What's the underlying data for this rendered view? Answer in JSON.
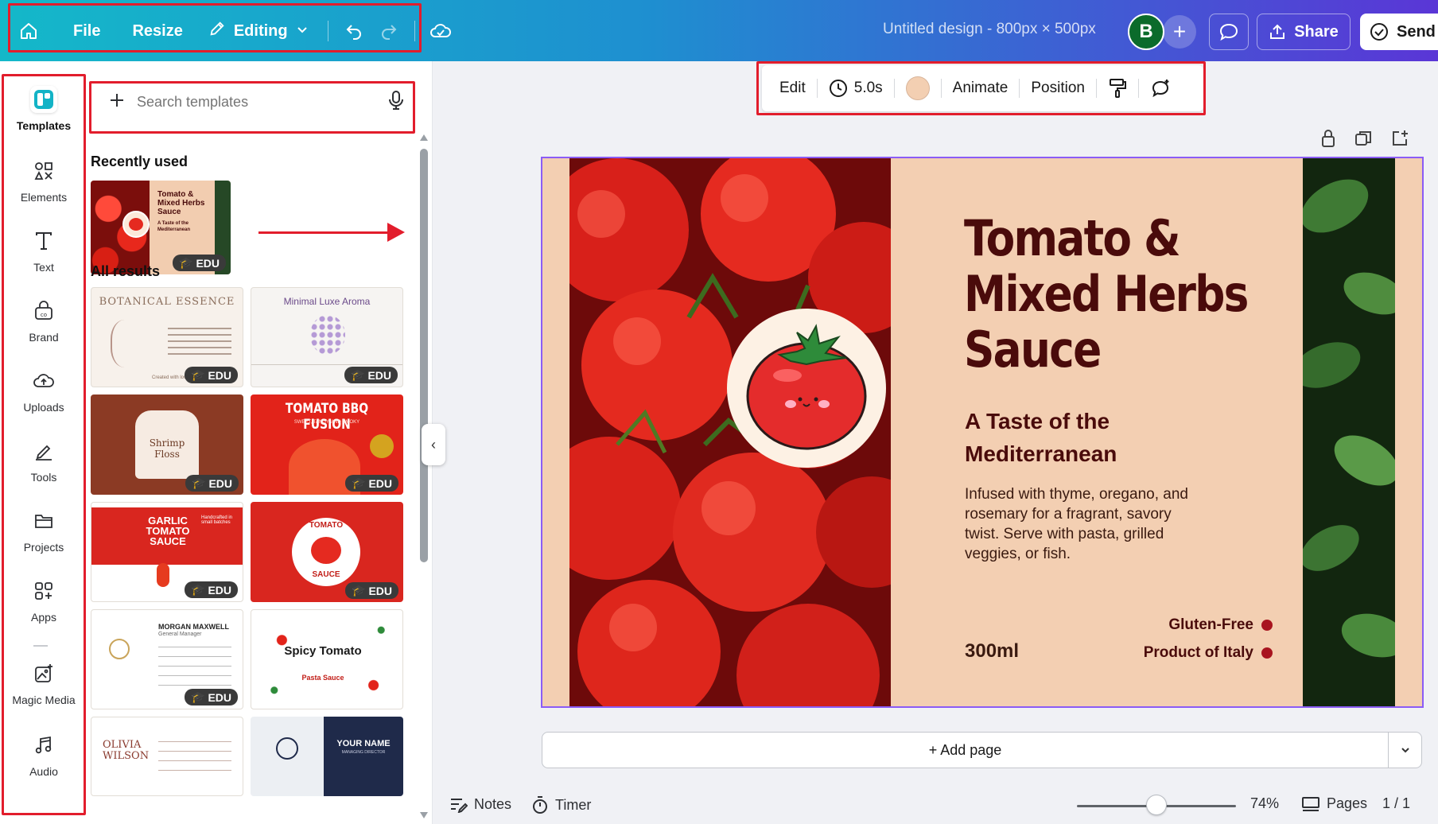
{
  "topbar": {
    "file": "File",
    "resize": "Resize",
    "editing": "Editing",
    "doc_title": "Untitled design - 800px × 500px",
    "avatar_initial": "B",
    "share": "Share",
    "send": "Send"
  },
  "rail": {
    "items": [
      {
        "label": "Templates",
        "icon": "templates-icon"
      },
      {
        "label": "Elements",
        "icon": "elements-icon"
      },
      {
        "label": "Text",
        "icon": "text-icon"
      },
      {
        "label": "Brand",
        "icon": "brand-icon"
      },
      {
        "label": "Uploads",
        "icon": "uploads-icon"
      },
      {
        "label": "Tools",
        "icon": "tools-icon"
      },
      {
        "label": "Projects",
        "icon": "projects-icon"
      },
      {
        "label": "Apps",
        "icon": "apps-icon"
      },
      {
        "label": "Magic Media",
        "icon": "magic-media-icon"
      },
      {
        "label": "Audio",
        "icon": "audio-icon"
      }
    ]
  },
  "panel": {
    "search_placeholder": "Search templates",
    "recently_used": "Recently used",
    "all_results": "All results",
    "edu_badge": "EDU",
    "recent_thumb": {
      "line1": "Tomato &",
      "line2": "Mixed Herbs",
      "line3": "Sauce",
      "line4": "A Taste of the",
      "line5": "Mediterranean"
    },
    "results": [
      {
        "title": "BOTANICAL ESSENCE",
        "sub": "Created with love"
      },
      {
        "title": "Minimal Luxe Aroma",
        "sub": ""
      },
      {
        "title": "Shrimp Floss",
        "sub": ""
      },
      {
        "title": "TOMATO BBQ FUSION",
        "sub": "SWEET, TANGY, AND SMOKY"
      },
      {
        "title": "GARLIC TOMATO SAUCE",
        "sub": "Handcrafted in small batches"
      },
      {
        "title": "TOMATO",
        "sub": "SAUCE"
      },
      {
        "title": "MORGAN MAXWELL",
        "sub": "General Manager"
      },
      {
        "title": "Spicy Tomato",
        "sub": "Pasta Sauce"
      },
      {
        "title": "OLIVIA WILSON",
        "sub": ""
      },
      {
        "title": "YOUR NAME",
        "sub": "MANAGING DIRECTOR"
      }
    ]
  },
  "context_bar": {
    "edit": "Edit",
    "duration": "5.0s",
    "swatch_color": "#f3cfb2",
    "animate": "Animate",
    "position": "Position"
  },
  "design": {
    "title": "Tomato &\nMixed Herbs\nSauce",
    "subtitle": "A Taste of the\nMediterranean",
    "body": "Infused with thyme, oregano, and rosemary for a fragrant, savory twist. Serve with pasta, grilled veggies, or fish.",
    "volume": "300ml",
    "tag1": "Gluten-Free",
    "tag2": "Product of Italy",
    "bg_color": "#f3cfb2",
    "text_color": "#4a0b0b"
  },
  "canvas": {
    "add_page": "+ Add page"
  },
  "bottom": {
    "notes": "Notes",
    "timer": "Timer",
    "zoom": "74%",
    "zoom_level": 0.74,
    "pages": "Pages",
    "page_count": "1 / 1"
  }
}
